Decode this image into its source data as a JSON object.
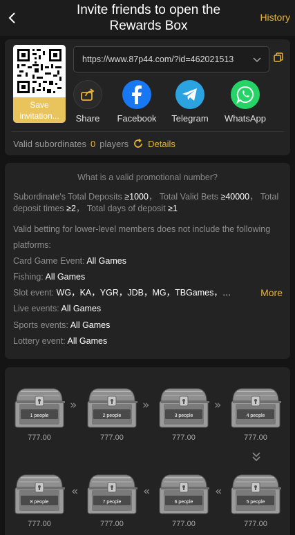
{
  "header": {
    "title_line1": "Invite friends to open the",
    "title_line2": "Rewards Box",
    "history_label": "History"
  },
  "invite": {
    "save_label_line1": "Save",
    "save_label_line2": "invitation...",
    "link": "https://www.87p44.com/?id=462021513",
    "share": [
      {
        "label": "Share",
        "icon": "share-icon",
        "color": "#2a2a2a"
      },
      {
        "label": "Facebook",
        "icon": "facebook-icon",
        "color": "#1877f2"
      },
      {
        "label": "Telegram",
        "icon": "telegram-icon",
        "color": "#2aa3e0"
      },
      {
        "label": "WhatsApp",
        "icon": "whatsapp-icon",
        "color": "#25d366"
      }
    ],
    "valid_label": "Valid subordinates",
    "valid_count": "0",
    "valid_unit": "players",
    "details_label": "Details"
  },
  "rules": {
    "title": "What is a valid promotional number?",
    "deposits_label": "Subordinate's Total Deposits",
    "deposits_value": "≥1000",
    "bets_label": "Total Valid Bets",
    "bets_value": "≥40000",
    "times_label_a": "Total",
    "times_label_b": "deposit times",
    "times_value": "≥2",
    "days_label": "Total days of deposit",
    "days_value": "≥1",
    "note_line1": "Valid betting for lower-level members does not include the following",
    "note_line2": "platforms:",
    "card_label": "Card Game Event:",
    "card_value": "All Games",
    "fishing_label": "Fishing:",
    "fishing_value": "All Games",
    "slot_label": "Slot event:",
    "slot_value": "WG，KA，YGR，JDB，MG，TBGames，…",
    "more_label": "More",
    "live_label": "Live events:",
    "live_value": "All Games",
    "sports_label": "Sports events:",
    "sports_value": "All Games",
    "lottery_label": "Lottery event:",
    "lottery_value": "All Games"
  },
  "boxes": [
    {
      "label": "1 people",
      "amount": "777.00"
    },
    {
      "label": "2 people",
      "amount": "777.00"
    },
    {
      "label": "3 people",
      "amount": "777.00"
    },
    {
      "label": "4 people",
      "amount": "777.00"
    },
    {
      "label": "5 people",
      "amount": "777.00"
    },
    {
      "label": "6 people",
      "amount": "777.00"
    },
    {
      "label": "7 people",
      "amount": "777.00"
    },
    {
      "label": "8 people",
      "amount": "777.00"
    }
  ],
  "colors": {
    "accent": "#e6b33a",
    "background": "#141414",
    "card": "#232323"
  }
}
